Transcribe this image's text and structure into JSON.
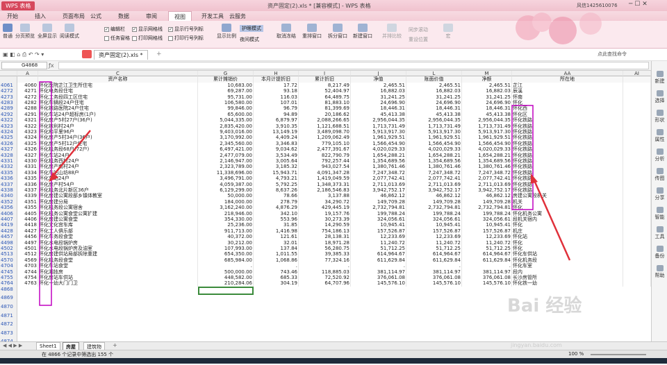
{
  "app": {
    "name": "WPS 表格",
    "title": "资产固定(2).xls * [兼容模式] - WPS 表格",
    "user": "风信1425610076"
  },
  "ribbon_tabs": [
    "开始",
    "插入",
    "页面布局",
    "公式",
    "数据",
    "审阅",
    "视图",
    "开发工具",
    "云服务"
  ],
  "active_tab": "视图",
  "ribbon": {
    "group1": [
      "普通",
      "分页预览",
      "全屏显示",
      "阅读模式"
    ],
    "checks_a": [
      "编辑栏",
      "任务窗格"
    ],
    "checks_b": [
      "显示网格线",
      "打印网格线"
    ],
    "checks_c": [
      "显示行号列标",
      "打印行号列标"
    ],
    "display_ratio": "显示比例",
    "eye_mode": "护眼模式",
    "night_mode": "夜间模式",
    "freeze": "取消冻结",
    "rearrange": "重排窗口",
    "split": "拆分窗口",
    "new_window": "新建窗口",
    "compare": "并排比较",
    "sync_scroll": "同步滚动",
    "reset_pos": "重设位置",
    "macro": "宏"
  },
  "doc_tab": "资产固定(2).xls *",
  "search_cmd": "点此查找命令",
  "name_box": "G4868",
  "col_headers": [
    "A",
    "C",
    "G",
    "H",
    "I",
    "J",
    "L",
    "M",
    "AA",
    "AI"
  ],
  "header_row": {
    "a": "",
    "c": "资产名称",
    "g": "累计摊销价",
    "h": "本月计提折旧",
    "i": "累计折旧",
    "j": "净值",
    "l": "账面价值",
    "m": "净额",
    "aa": "所在地"
  },
  "rows": [
    {
      "rn": "4061",
      "a": "4060",
      "c": "怀化医院芷江卫生所住宅",
      "g": "10,683.00",
      "h": "17.72",
      "i": "8,217.49",
      "j": "2,465.51",
      "l": "2,465.51",
      "m": "2,465.51",
      "aa": "芷江"
    },
    {
      "rn": "4272",
      "a": "4271",
      "c": "怀化电务段住宅",
      "g": "69,287.00",
      "h": "93.18",
      "i": "52,404.97",
      "j": "16,882.03",
      "l": "16,882.03",
      "m": "16,882.03",
      "aa": "辰溪"
    },
    {
      "rn": "4273",
      "a": "4272",
      "c": "怀化工务段四工区住宅",
      "g": "95,731.00",
      "h": "116.03",
      "i": "64,489.75",
      "j": "31,241.25",
      "l": "31,241.25",
      "m": "31,241.25",
      "aa": "怀南"
    },
    {
      "rn": "4283",
      "a": "4282",
      "c": "怀化车辆段24户住宅",
      "g": "106,580.00",
      "h": "107.01",
      "i": "81,883.10",
      "j": "24,696.90",
      "l": "24,696.90",
      "m": "24,696.90",
      "aa": "怀化"
    },
    {
      "rn": "4289",
      "a": "4288",
      "c": "怀化铁路医院24户住宅",
      "g": "99,846.00",
      "h": "96.79",
      "i": "81,399.69",
      "j": "18,446.31",
      "l": "18,446.31",
      "m": "18,446.31",
      "aa": "怀化西"
    },
    {
      "rn": "4292",
      "a": "4291",
      "c": "怀化车站24户超标房(1户)",
      "g": "65,600.00",
      "h": "94.89",
      "i": "20,186.62",
      "j": "45,413.38",
      "l": "45,413.38",
      "m": "45,413.38",
      "aa": "怀化区"
    },
    {
      "rn": "4322",
      "a": "4321",
      "c": "怀化房产5村27户(36户)",
      "g": "5,044,335.00",
      "h": "6,879.97",
      "i": "2,088,266.65",
      "j": "2,956,044.35",
      "l": "2,956,044.35",
      "m": "2,956,044.35",
      "aa": "怀化铁路"
    },
    {
      "rn": "4323",
      "a": "4322",
      "c": "怀化铁利村24户",
      "g": "2,835,420.00",
      "h": "3,910.35",
      "i": "1,121,688.51",
      "j": "1,713,731.49",
      "l": "1,713,731.49",
      "m": "1,713,731.49",
      "aa": "怀化铁路"
    },
    {
      "rn": "4324",
      "a": "4323",
      "c": "怀化和平里96户",
      "g": "9,403,016.00",
      "h": "13,149.19",
      "i": "3,489,098.70",
      "j": "5,913,917.30",
      "l": "5,913,917.30",
      "m": "5,913,917.30",
      "aa": "怀化铁路"
    },
    {
      "rn": "4325",
      "a": "4324",
      "c": "怀化房产5村34户(36户)",
      "g": "3,170,992.00",
      "h": "4,409.24",
      "i": "1,209,062.49",
      "j": "1,961,929.51",
      "l": "1,961,929.51",
      "m": "1,961,929.51",
      "aa": "怀化铁路"
    },
    {
      "rn": "4326",
      "a": "4325",
      "c": "怀化房产5村12户住宅",
      "g": "2,345,560.00",
      "h": "3,346.83",
      "i": "779,105.10",
      "j": "1,566,454.90",
      "l": "1,566,454.90",
      "m": "1,566,454.90",
      "aa": "怀化铁路"
    },
    {
      "rn": "4327",
      "a": "4326",
      "c": "怀化机务段68户(72户)",
      "g": "6,497,421.00",
      "h": "9,034.62",
      "i": "2,477,391.67",
      "j": "4,020,029.33",
      "l": "4,020,029.33",
      "m": "4,020,029.33",
      "aa": "怀化铁路"
    },
    {
      "rn": "4328",
      "a": "4327",
      "c": "怀化车站24户",
      "g": "2,477,079.00",
      "h": "3,534.49",
      "i": "822,790.79",
      "j": "1,654,288.21",
      "l": "1,654,288.21",
      "m": "1,654,288.21",
      "aa": "怀化铁路"
    },
    {
      "rn": "4331",
      "a": "4330",
      "c": "怀化机务西村24户",
      "g": "2,146,947.00",
      "h": "3,005.64",
      "i": "792,257.44",
      "j": "1,354,689.56",
      "l": "1,354,689.56",
      "m": "1,354,689.56",
      "aa": "怀化铁路"
    },
    {
      "rn": "4332",
      "a": "4331",
      "c": "怀化房产南村24户",
      "g": "2,323,789.00",
      "h": "3,185.32",
      "i": "943,027.54",
      "j": "1,380,761.46",
      "l": "1,380,761.46",
      "m": "1,380,761.46",
      "aa": "怀化铁路"
    },
    {
      "rn": "4335",
      "a": "4334",
      "c": "怀化车站山坊88户",
      "g": "11,338,696.00",
      "h": "15,943.71",
      "i": "4,091,347.28",
      "j": "7,247,348.72",
      "l": "7,247,348.72",
      "m": "7,247,348.72",
      "aa": "怀化铁路"
    },
    {
      "rn": "4336",
      "a": "4335",
      "c": "怀化车站24户",
      "g": "3,496,791.00",
      "h": "4,793.21",
      "i": "1,419,049.59",
      "j": "2,077,742.41",
      "l": "2,077,742.41",
      "m": "2,077,742.41",
      "aa": "怀化铁路"
    },
    {
      "rn": "4337",
      "a": "4336",
      "c": "怀化房产村54户",
      "g": "4,059,387.00",
      "h": "5,792.25",
      "i": "1,348,373.31",
      "j": "2,711,013.69",
      "l": "2,711,013.69",
      "m": "2,711,013.69",
      "aa": "怀化铁路"
    },
    {
      "rn": "4338",
      "a": "4337",
      "c": "怀化机务北片新区36户",
      "g": "6,129,299.00",
      "h": "8,637.26",
      "i": "2,186,546.83",
      "j": "3,942,752.17",
      "l": "3,942,752.17",
      "m": "3,942,752.17",
      "aa": "怀化铁路"
    },
    {
      "rn": "4340",
      "a": "4339",
      "c": "怀化房建公寓段部乡镇体教室",
      "g": "50,000.00",
      "h": "78.66",
      "i": "3,137.88",
      "j": "46,862.12",
      "l": "46,862.12",
      "m": "46,862.12",
      "aa": "房建公寓段机关"
    },
    {
      "rn": "4352",
      "a": "4351",
      "c": "怀化房建分局",
      "g": "184,000.00",
      "h": "278.79",
      "i": "34,290.72",
      "j": "149,709.28",
      "l": "149,709.28",
      "m": "149,709.28",
      "aa": "机关"
    },
    {
      "rn": "4356",
      "a": "4355",
      "c": "怀化机务段公寓宿舍",
      "g": "3,162,240.00",
      "h": "4,876.29",
      "i": "429,445.19",
      "j": "2,732,794.81",
      "l": "2,732,794.81",
      "m": "2,732,794.81",
      "aa": "怀化"
    },
    {
      "rn": "4406",
      "a": "4405",
      "c": "怀化机务公寓食堂公寓扩建",
      "g": "218,946.00",
      "h": "342.10",
      "i": "19,157.76",
      "j": "199,788.24",
      "l": "199,788.24",
      "m": "199,788.24",
      "aa": "怀化机务公寓"
    },
    {
      "rn": "4407",
      "a": "4406",
      "c": "怀化房建公寓食堂",
      "g": "354,330.00",
      "h": "553.96",
      "i": "30,273.39",
      "j": "324,056.61",
      "l": "324,056.61",
      "m": "324,056.61",
      "aa": "段机关宿内"
    },
    {
      "rn": "4419",
      "a": "4418",
      "c": "怀化文化宫车库",
      "g": "25,236.00",
      "h": "31.85",
      "i": "14,290.59",
      "j": "10,945.41",
      "l": "10,945.41",
      "m": "10,945.41",
      "aa": "怀化"
    },
    {
      "rn": "4428",
      "a": "4427",
      "c": "怀化工人俱乐部",
      "g": "911,713.00",
      "h": "1,416.98",
      "i": "754,186.13",
      "j": "157,526.87",
      "l": "157,526.87",
      "m": "157,526.87",
      "aa": "机庄"
    },
    {
      "rn": "4457",
      "a": "4456",
      "c": "怀化车务段食堂",
      "g": "40,372.00",
      "h": "121.61",
      "i": "28,138.31",
      "j": "12,233.69",
      "l": "12,233.69",
      "m": "12,233.69",
      "aa": "怀化站"
    },
    {
      "rn": "4498",
      "a": "4497",
      "c": "怀化水电段锅炉房",
      "g": "30,212.00",
      "h": "32.01",
      "i": "18,971.28",
      "j": "11,240.72",
      "l": "11,240.72",
      "m": "11,240.72",
      "aa": "怀化"
    },
    {
      "rn": "4502",
      "a": "4501",
      "c": "怀化水电段锅炉房及油室",
      "g": "107,993.00",
      "h": "137.84",
      "i": "56,280.75",
      "j": "51,712.25",
      "l": "51,712.25",
      "m": "51,712.25",
      "aa": "怀化"
    },
    {
      "rn": "4513",
      "a": "4512",
      "c": "怀化房建供站局部拆除重建",
      "g": "654,350.00",
      "h": "1,011.55",
      "i": "39,385.33",
      "j": "614,964.67",
      "l": "614,964.67",
      "m": "614,964.67",
      "aa": "怀化车供站"
    },
    {
      "rn": "4570",
      "a": "4569",
      "c": "怀化机务段食堂",
      "g": "685,984.00",
      "h": "1,068.86",
      "i": "77,324.16",
      "j": "611,629.84",
      "l": "611,629.84",
      "m": "611,629.84",
      "aa": "怀化机务段"
    },
    {
      "rn": "4704",
      "a": "4703",
      "c": "怀化车站食堂",
      "g": ".",
      "h": ".",
      "i": ".",
      "j": ".",
      "l": ".",
      "m": ".",
      "aa": "怀化车室"
    },
    {
      "rn": "4745",
      "a": "4744",
      "c": "怀化湘技房",
      "g": "500,000.00",
      "h": "743.46",
      "i": "118,885.03",
      "j": "381,114.97",
      "l": "381,114.97",
      "m": "381,114.97",
      "aa": "段内"
    },
    {
      "rn": "4755",
      "a": "4754",
      "c": "怀化房站车供站",
      "g": "448,582.00",
      "h": "685.33",
      "i": "72,520.92",
      "j": "376,061.08",
      "l": "376,061.08",
      "m": "376,061.08",
      "aa": "长沙房管所"
    },
    {
      "rn": "4764",
      "a": "4763",
      "c": "怀化一幼大门门卫",
      "g": "210,284.06",
      "h": "304.19",
      "i": "64,707.96",
      "j": "145,576.10",
      "l": "145,576.10",
      "m": "145,576.10",
      "aa": "怀化铁一幼"
    }
  ],
  "empty_rows": [
    "4868",
    "4869",
    "4870",
    "4871",
    "4872",
    "4873",
    "4874"
  ],
  "sheets": [
    "Sheet1",
    "房屋",
    "建筑物"
  ],
  "active_sheet": "房屋",
  "status_text": "在 4866 个记录中筛选出 155 个",
  "zoom": "100 %",
  "side_items": [
    "新建",
    "选择",
    "形状",
    "属性",
    "分析",
    "传图",
    "分享",
    "智能",
    "工具",
    "备份",
    "帮助"
  ],
  "colors": {
    "accent": "#d06a86",
    "highlight_box": "#c000c0",
    "arrow": "#e0303a",
    "selected_cell": "#3a8a3a"
  }
}
